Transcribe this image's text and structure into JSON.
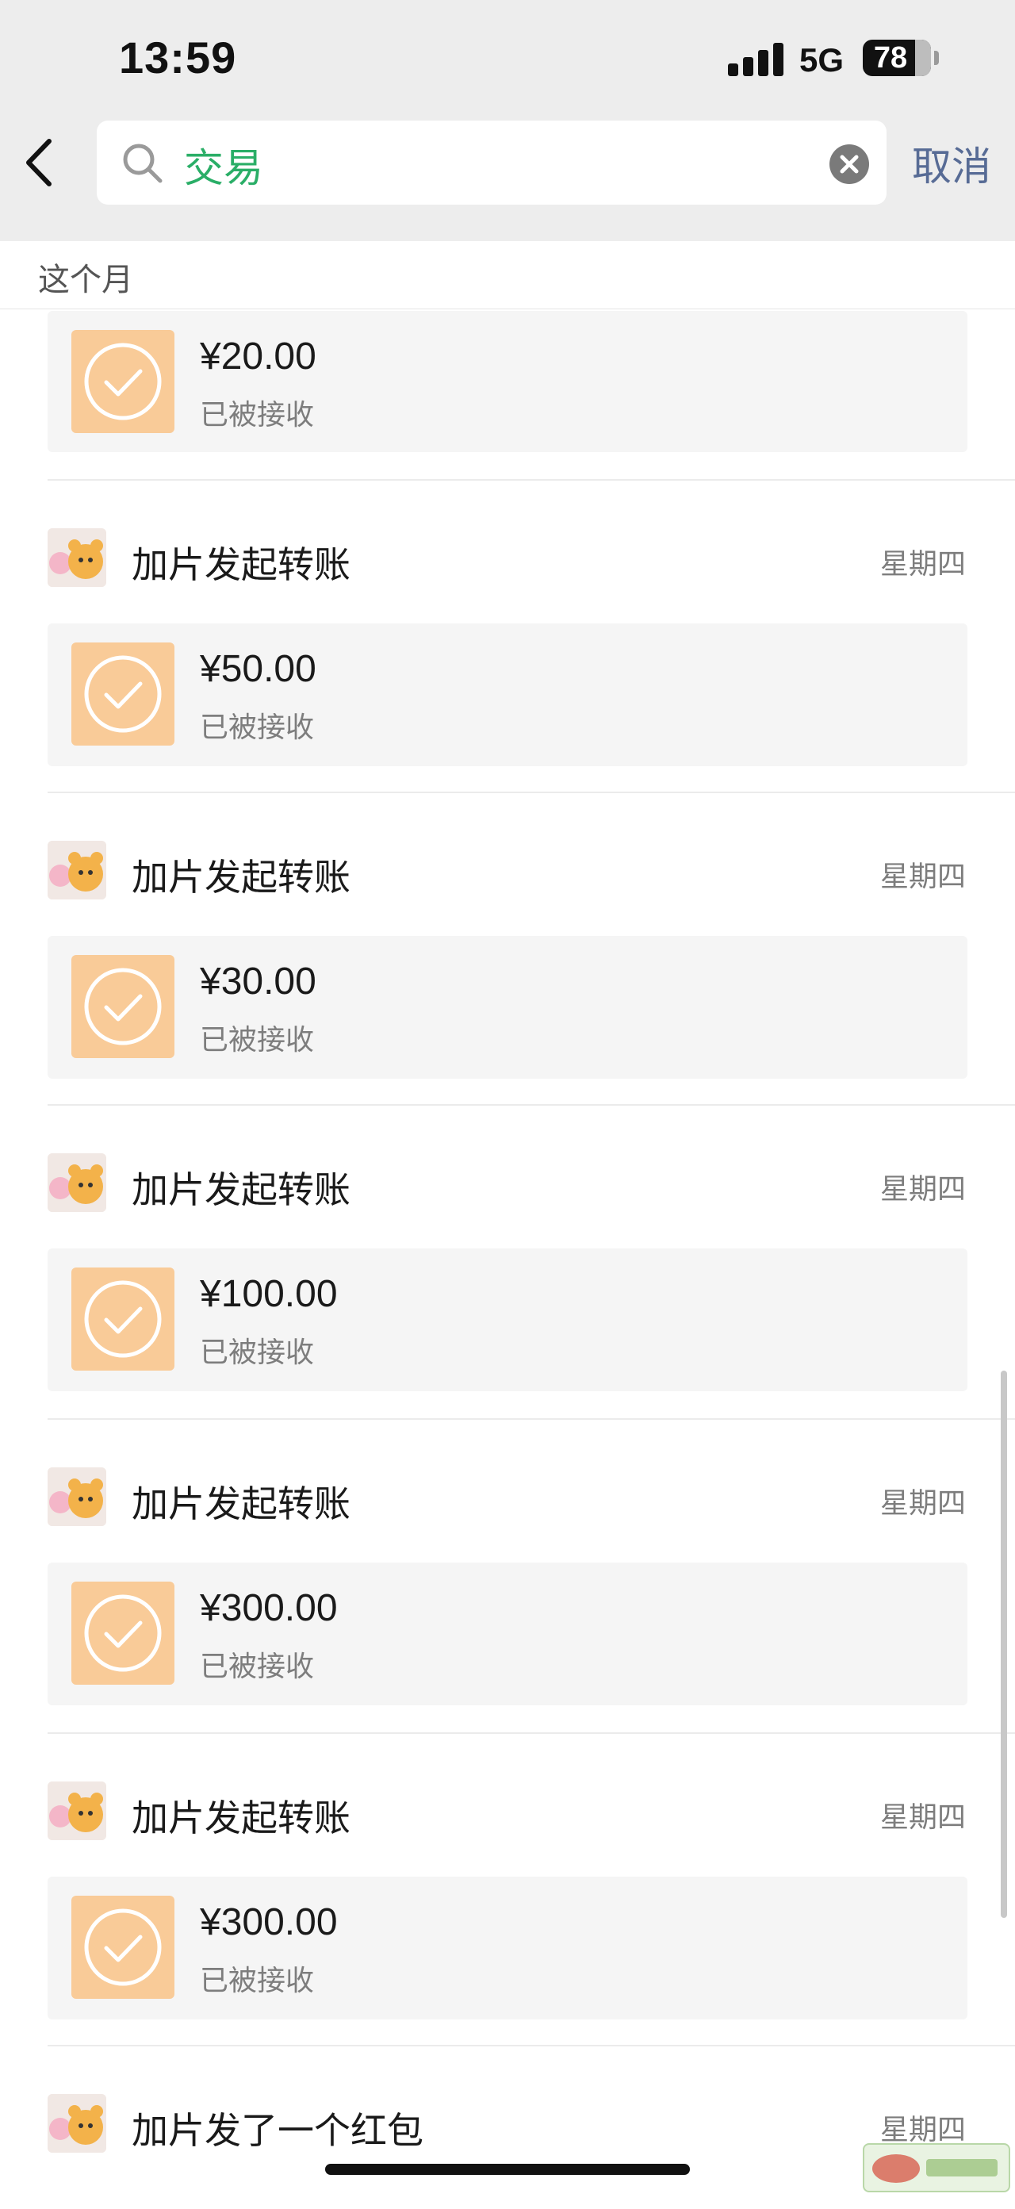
{
  "status_bar": {
    "time": "13:59",
    "network": "5G",
    "battery": "78"
  },
  "search": {
    "query": "交易",
    "cancel_label": "取消"
  },
  "section": {
    "label": "这个月"
  },
  "partial_entry": {
    "amount": "¥20.00",
    "status": "已被接收"
  },
  "entries": [
    {
      "title": "加片发起转账",
      "date": "星期四",
      "amount": "¥50.00",
      "status": "已被接收"
    },
    {
      "title": "加片发起转账",
      "date": "星期四",
      "amount": "¥30.00",
      "status": "已被接收"
    },
    {
      "title": "加片发起转账",
      "date": "星期四",
      "amount": "¥100.00",
      "status": "已被接收"
    },
    {
      "title": "加片发起转账",
      "date": "星期四",
      "amount": "¥300.00",
      "status": "已被接收"
    },
    {
      "title": "加片发起转账",
      "date": "星期四",
      "amount": "¥300.00",
      "status": "已被接收"
    },
    {
      "title": "加片发了一个红包",
      "date": "星期四"
    }
  ],
  "colors": {
    "accent_green": "#2aae67",
    "link_blue": "#576b95",
    "transfer_icon": "#f9cb98"
  },
  "icons": [
    "back-chevron-icon",
    "search-icon",
    "clear-icon",
    "check-circle-icon",
    "avatar"
  ]
}
